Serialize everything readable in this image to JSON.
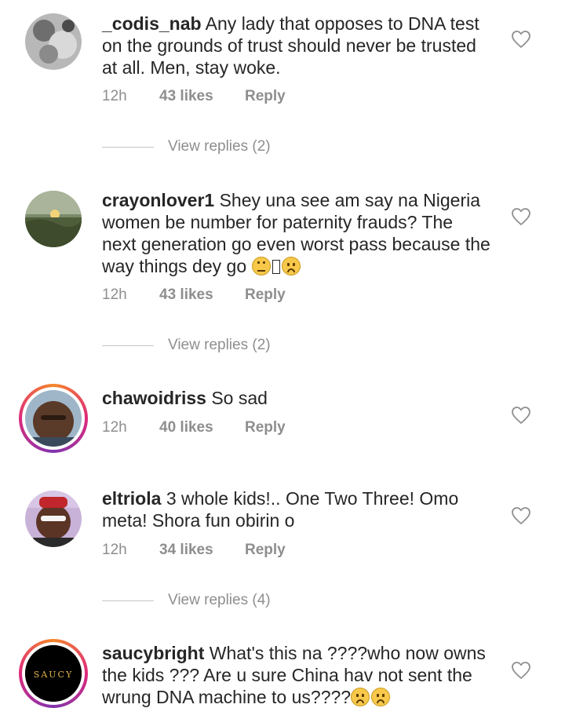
{
  "comments": [
    {
      "username": "_codis_nab",
      "text": "Any lady that opposes to DNA test on the grounds of trust should never be trusted at all. Men, stay woke.",
      "time": "12h",
      "likes": "43 likes",
      "reply": "Reply",
      "view_replies": "View replies (2)"
    },
    {
      "username": "crayonlover1",
      "text": "Shey una see am say na Nigeria women be number for paternity frauds? The next generation go even worst pass because the way things dey go",
      "emojis": [
        "face-with-rolling-eyes",
        "missing-glyph",
        "frowning-face"
      ],
      "time": "12h",
      "likes": "43 likes",
      "reply": "Reply",
      "view_replies": "View replies (2)"
    },
    {
      "username": "chawoidriss",
      "text": "So sad",
      "time": "12h",
      "likes": "40 likes",
      "reply": "Reply"
    },
    {
      "username": "eltriola",
      "text": "3 whole kids!.. One Two Three! Omo meta! Shora fun obirin o",
      "time": "12h",
      "likes": "34 likes",
      "reply": "Reply",
      "view_replies": "View replies (4)"
    },
    {
      "username": "saucybright",
      "text": "What's this na ????who now owns the kids ??? Are u sure China hav not sent the wrung DNA machine to us????",
      "emojis": [
        "frowning-face",
        "frowning-face"
      ],
      "avatar_text": "SAUCY"
    }
  ],
  "icons": {
    "like": "heart-outline-icon"
  },
  "colors": {
    "text": "#262626",
    "meta": "#8e8e8e",
    "story_ring": "#dd2a7b"
  }
}
